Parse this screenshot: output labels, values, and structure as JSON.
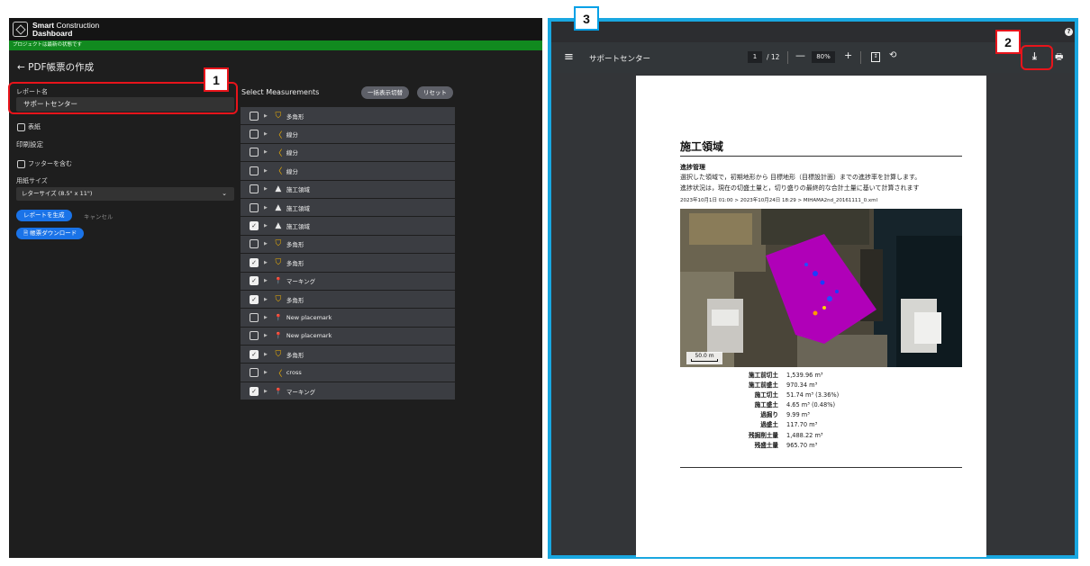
{
  "app": {
    "brand_line1_bold": "Smart",
    "brand_line1_rest": " Construction",
    "brand_line2": "Dashboard",
    "status": "プロジェクトは最新の状態です",
    "page_title": "← PDF帳票の作成",
    "report_name_label": "レポート名",
    "report_name_value": "サポートセンター",
    "cover_label": "表紙",
    "print_settings": "印刷設定",
    "footer_label": "フッターを含む",
    "paper_size_label": "用紙サイズ",
    "paper_size_value": "レターサイズ (8.5\" x 11\")",
    "generate_button": "レポートを生成",
    "cancel_button": "キャンセル",
    "download_button": "帳票ダウンロード"
  },
  "measurements": {
    "title": "Select Measurements",
    "toggle_all_button": "一括表示切替",
    "reset_button": "リセット",
    "items": [
      {
        "label": "多角形",
        "icon": "polygon-icon",
        "checked": false
      },
      {
        "label": "線分",
        "icon": "polyline-icon",
        "checked": false
      },
      {
        "label": "線分",
        "icon": "polyline-icon",
        "checked": false
      },
      {
        "label": "線分",
        "icon": "polyline-icon",
        "checked": false
      },
      {
        "label": "施工領域",
        "icon": "mountain-icon",
        "checked": false
      },
      {
        "label": "施工領域",
        "icon": "mountain-icon",
        "checked": false
      },
      {
        "label": "施工領域",
        "icon": "mountain-icon",
        "checked": true
      },
      {
        "label": "多角形",
        "icon": "polygon-icon",
        "checked": false
      },
      {
        "label": "多角形",
        "icon": "polygon-icon",
        "checked": true
      },
      {
        "label": "マーキング",
        "icon": "pin-icon",
        "checked": true
      },
      {
        "label": "多角形",
        "icon": "polygon-icon",
        "checked": true
      },
      {
        "label": "New placemark",
        "icon": "pin-blue-icon",
        "checked": false
      },
      {
        "label": "New placemark",
        "icon": "pin-icon",
        "checked": false
      },
      {
        "label": "多角形",
        "icon": "polygon-icon",
        "checked": true
      },
      {
        "label": "cross",
        "icon": "polyline-icon",
        "checked": false
      },
      {
        "label": "マーキング",
        "icon": "pin-icon",
        "checked": true
      }
    ]
  },
  "annotations": {
    "one": "1",
    "two": "2",
    "three": "3"
  },
  "viewer": {
    "title": "サポートセンター",
    "page_current": "1",
    "page_total": "/ 12",
    "zoom": "80%"
  },
  "pdf": {
    "heading": "施工領域",
    "subheading": "進捗管理",
    "line1": "選択した領域で，初期地形から 目標地形（目標設計面）までの進捗率を計算します。",
    "line2": "進捗状況は，現在の切盛土量と，切り盛りの最終的な合計土量に基いて計算されます",
    "line3": "2023年10月1日 01:00 > 2023年10月24日 18:29 > MIHAMA2nd_20161111_0.xml",
    "scale": "50.0 m",
    "stats": [
      {
        "k": "施工前切土",
        "v": "1,539.96 m³"
      },
      {
        "k": "施工前盛土",
        "v": "970.34 m³"
      },
      {
        "k": "施工切土",
        "v": "51.74 m³ (3.36%)"
      },
      {
        "k": "施工盛土",
        "v": "4.65 m³ (0.48%)"
      },
      {
        "k": "過掘り",
        "v": "9.99 m³"
      },
      {
        "k": "過盛土",
        "v": "117.70 m³"
      },
      {
        "k": "残掘削土量",
        "v": "1,488.22 m³"
      },
      {
        "k": "残盛土量",
        "v": "965.70 m³"
      }
    ]
  },
  "colors": {
    "accent": "#1a73e8",
    "annotation_red": "#e8141b",
    "annotation_blue": "#19a7e0",
    "status_green": "#118a1f",
    "area_magenta": "#b000b8"
  }
}
